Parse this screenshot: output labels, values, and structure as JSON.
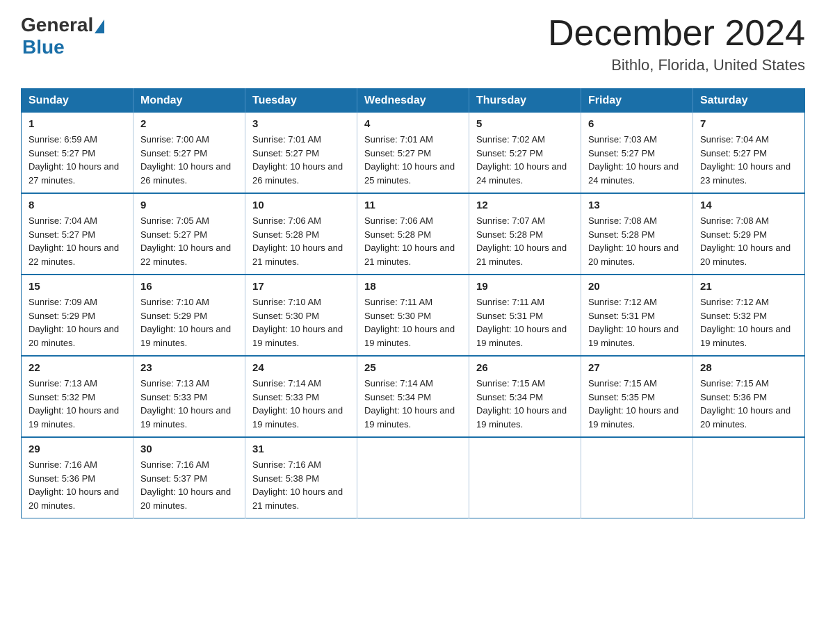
{
  "logo": {
    "general": "General",
    "blue": "Blue"
  },
  "title": {
    "month_year": "December 2024",
    "location": "Bithlo, Florida, United States"
  },
  "days_of_week": [
    "Sunday",
    "Monday",
    "Tuesday",
    "Wednesday",
    "Thursday",
    "Friday",
    "Saturday"
  ],
  "weeks": [
    [
      {
        "day": "1",
        "sunrise": "6:59 AM",
        "sunset": "5:27 PM",
        "daylight": "10 hours and 27 minutes."
      },
      {
        "day": "2",
        "sunrise": "7:00 AM",
        "sunset": "5:27 PM",
        "daylight": "10 hours and 26 minutes."
      },
      {
        "day": "3",
        "sunrise": "7:01 AM",
        "sunset": "5:27 PM",
        "daylight": "10 hours and 26 minutes."
      },
      {
        "day": "4",
        "sunrise": "7:01 AM",
        "sunset": "5:27 PM",
        "daylight": "10 hours and 25 minutes."
      },
      {
        "day": "5",
        "sunrise": "7:02 AM",
        "sunset": "5:27 PM",
        "daylight": "10 hours and 24 minutes."
      },
      {
        "day": "6",
        "sunrise": "7:03 AM",
        "sunset": "5:27 PM",
        "daylight": "10 hours and 24 minutes."
      },
      {
        "day": "7",
        "sunrise": "7:04 AM",
        "sunset": "5:27 PM",
        "daylight": "10 hours and 23 minutes."
      }
    ],
    [
      {
        "day": "8",
        "sunrise": "7:04 AM",
        "sunset": "5:27 PM",
        "daylight": "10 hours and 22 minutes."
      },
      {
        "day": "9",
        "sunrise": "7:05 AM",
        "sunset": "5:27 PM",
        "daylight": "10 hours and 22 minutes."
      },
      {
        "day": "10",
        "sunrise": "7:06 AM",
        "sunset": "5:28 PM",
        "daylight": "10 hours and 21 minutes."
      },
      {
        "day": "11",
        "sunrise": "7:06 AM",
        "sunset": "5:28 PM",
        "daylight": "10 hours and 21 minutes."
      },
      {
        "day": "12",
        "sunrise": "7:07 AM",
        "sunset": "5:28 PM",
        "daylight": "10 hours and 21 minutes."
      },
      {
        "day": "13",
        "sunrise": "7:08 AM",
        "sunset": "5:28 PM",
        "daylight": "10 hours and 20 minutes."
      },
      {
        "day": "14",
        "sunrise": "7:08 AM",
        "sunset": "5:29 PM",
        "daylight": "10 hours and 20 minutes."
      }
    ],
    [
      {
        "day": "15",
        "sunrise": "7:09 AM",
        "sunset": "5:29 PM",
        "daylight": "10 hours and 20 minutes."
      },
      {
        "day": "16",
        "sunrise": "7:10 AM",
        "sunset": "5:29 PM",
        "daylight": "10 hours and 19 minutes."
      },
      {
        "day": "17",
        "sunrise": "7:10 AM",
        "sunset": "5:30 PM",
        "daylight": "10 hours and 19 minutes."
      },
      {
        "day": "18",
        "sunrise": "7:11 AM",
        "sunset": "5:30 PM",
        "daylight": "10 hours and 19 minutes."
      },
      {
        "day": "19",
        "sunrise": "7:11 AM",
        "sunset": "5:31 PM",
        "daylight": "10 hours and 19 minutes."
      },
      {
        "day": "20",
        "sunrise": "7:12 AM",
        "sunset": "5:31 PM",
        "daylight": "10 hours and 19 minutes."
      },
      {
        "day": "21",
        "sunrise": "7:12 AM",
        "sunset": "5:32 PM",
        "daylight": "10 hours and 19 minutes."
      }
    ],
    [
      {
        "day": "22",
        "sunrise": "7:13 AM",
        "sunset": "5:32 PM",
        "daylight": "10 hours and 19 minutes."
      },
      {
        "day": "23",
        "sunrise": "7:13 AM",
        "sunset": "5:33 PM",
        "daylight": "10 hours and 19 minutes."
      },
      {
        "day": "24",
        "sunrise": "7:14 AM",
        "sunset": "5:33 PM",
        "daylight": "10 hours and 19 minutes."
      },
      {
        "day": "25",
        "sunrise": "7:14 AM",
        "sunset": "5:34 PM",
        "daylight": "10 hours and 19 minutes."
      },
      {
        "day": "26",
        "sunrise": "7:15 AM",
        "sunset": "5:34 PM",
        "daylight": "10 hours and 19 minutes."
      },
      {
        "day": "27",
        "sunrise": "7:15 AM",
        "sunset": "5:35 PM",
        "daylight": "10 hours and 19 minutes."
      },
      {
        "day": "28",
        "sunrise": "7:15 AM",
        "sunset": "5:36 PM",
        "daylight": "10 hours and 20 minutes."
      }
    ],
    [
      {
        "day": "29",
        "sunrise": "7:16 AM",
        "sunset": "5:36 PM",
        "daylight": "10 hours and 20 minutes."
      },
      {
        "day": "30",
        "sunrise": "7:16 AM",
        "sunset": "5:37 PM",
        "daylight": "10 hours and 20 minutes."
      },
      {
        "day": "31",
        "sunrise": "7:16 AM",
        "sunset": "5:38 PM",
        "daylight": "10 hours and 21 minutes."
      },
      null,
      null,
      null,
      null
    ]
  ],
  "labels": {
    "sunrise": "Sunrise:",
    "sunset": "Sunset:",
    "daylight": "Daylight:"
  }
}
